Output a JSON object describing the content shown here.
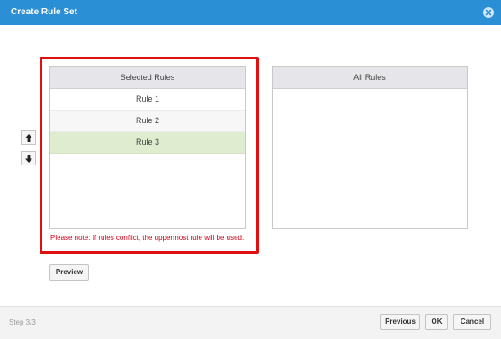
{
  "dialog": {
    "title": "Create Rule Set"
  },
  "selected_panel": {
    "header": "Selected Rules",
    "rules": [
      {
        "label": "Rule 1"
      },
      {
        "label": "Rule 2"
      },
      {
        "label": "Rule 3"
      }
    ],
    "selected_rule": "Rule 3"
  },
  "all_panel": {
    "header": "All Rules"
  },
  "note": "Please note: If rules conflict, the uppermost rule will be used.",
  "buttons": {
    "preview": "Preview",
    "previous": "Previous",
    "ok": "OK",
    "cancel": "Cancel"
  },
  "footer": {
    "step": "Step 3/3"
  },
  "colors": {
    "titlebar": "#2a8fd4",
    "highlight_border": "#e01010",
    "selected_row": "#dfeccf",
    "note_text": "#d0021b"
  },
  "icons": {
    "close": "close-circle-icon",
    "move_up": "arrow-up-icon",
    "move_down": "arrow-down-icon"
  }
}
